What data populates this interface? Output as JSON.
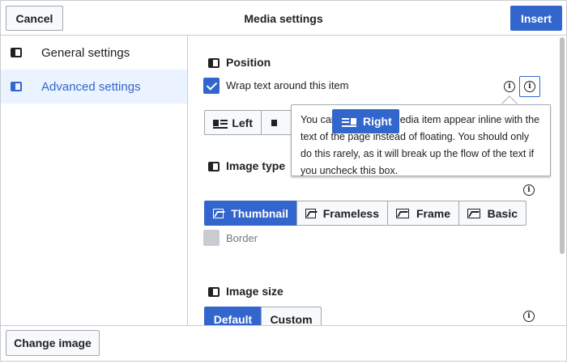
{
  "header": {
    "title": "Media settings",
    "cancel_label": "Cancel",
    "insert_label": "Insert"
  },
  "sidebar": {
    "items": [
      {
        "label": "General settings",
        "active": false
      },
      {
        "label": "Advanced settings",
        "active": true
      }
    ]
  },
  "position": {
    "heading": "Position",
    "wrap_label": "Wrap text around this item",
    "wrap_checked": true,
    "alignment_options": [
      "Left",
      "Center",
      "Right"
    ],
    "visible_left": "Left",
    "dragged_option": "Right"
  },
  "popup": {
    "text": "You can make this media item appear inline with the text of the page instead of floating. You should only do this rarely, as it will break up the flow of the text if you uncheck this box.",
    "visible_line1_a": "You can",
    "visible_line1_b": "edia item appear inline with the",
    "visible_line2_a": "text of th",
    "visible_line2_b": "e page instead of floating. You should only",
    "visible_line3": "do this rarely, as it will break up the flow of the text if",
    "visible_line4": "you uncheck this box."
  },
  "image_type": {
    "heading": "Image type",
    "options": [
      "Thumbnail",
      "Frameless",
      "Frame",
      "Basic"
    ],
    "selected": "Thumbnail",
    "border_label": "Border",
    "border_checked": false
  },
  "image_size": {
    "heading": "Image size",
    "options": [
      "Default",
      "Custom"
    ],
    "selected": "Default"
  },
  "footer": {
    "change_image_label": "Change image"
  },
  "colors": {
    "accent": "#3366cc",
    "border": "#c8ccd1",
    "active_bg": "#eaf3ff"
  },
  "icons": {
    "info": "info-icon",
    "section": "panel-icon",
    "image": "image-icon",
    "align": "align-icon"
  }
}
